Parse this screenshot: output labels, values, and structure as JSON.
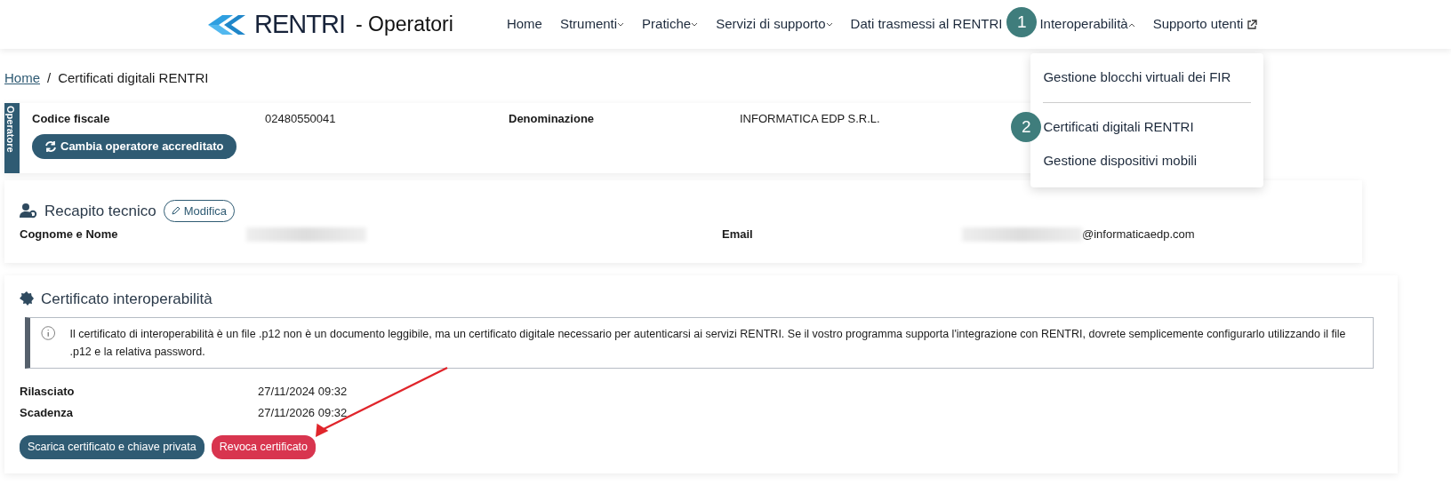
{
  "header": {
    "logo_text": "RENTRI",
    "subtitle": "- Operatori",
    "nav": [
      {
        "label": "Home",
        "kind": "plain",
        "expanded": false
      },
      {
        "label": "Strumenti",
        "kind": "dropdown",
        "expanded": false
      },
      {
        "label": "Pratiche",
        "kind": "dropdown",
        "expanded": false
      },
      {
        "label": "Servizi di supporto",
        "kind": "dropdown",
        "expanded": false
      },
      {
        "label": "Dati trasmessi al RENTRI",
        "kind": "plain",
        "expanded": false
      },
      {
        "label": "Interoperabilità",
        "kind": "dropdown",
        "expanded": true,
        "step": "1",
        "menu": [
          {
            "label": "Gestione blocchi virtuali dei FIR",
            "kind": "item"
          },
          {
            "kind": "divider"
          },
          {
            "label": "Certificati digitali RENTRI",
            "kind": "item",
            "step": "2"
          },
          {
            "label": "Gestione dispositivi mobili",
            "kind": "item"
          }
        ]
      },
      {
        "label": "Supporto utenti",
        "kind": "external",
        "expanded": false
      }
    ]
  },
  "breadcrumb": [
    {
      "label": "Home",
      "kind": "link"
    },
    {
      "label": "/",
      "kind": "separator"
    },
    {
      "label": "Certificati digitali RENTRI",
      "kind": "current"
    }
  ],
  "operator": {
    "tab": "Operatore",
    "fields": [
      {
        "label": "Codice fiscale",
        "value": "02480550041"
      },
      {
        "label": "Denominazione",
        "value": "INFORMATICA EDP S.R.L."
      }
    ],
    "button": "Cambia operatore accreditato"
  },
  "contact": {
    "title": "Recapito tecnico",
    "edit_button": "Modifica",
    "fields": [
      {
        "label": "Cognome e Nome",
        "redacted": true
      },
      {
        "label": "Email",
        "redacted": true,
        "value": "@informaticaedp.com"
      }
    ]
  },
  "certificate": {
    "title": "Certificato interoperabilità",
    "info": "Il certificato di interoperabilità è un file .p12 non è un documento leggibile, ma un certificato digitale necessario per autenticarsi ai servizi RENTRI. Se il vostro programma supporta l'integrazione con RENTRI, dovrete semplicemente configurarlo utilizzando il file .p12 e la relativa password.",
    "fields": [
      {
        "label": "Rilasciato",
        "value": "27/11/2024 09:32"
      },
      {
        "label": "Scadenza",
        "value": "27/11/2026 09:32"
      }
    ],
    "buttons": [
      {
        "label": "Scarica certificato e chiave privata",
        "kind": "primary"
      },
      {
        "label": "Revoca certificato",
        "kind": "danger",
        "arrow": true
      }
    ]
  }
}
